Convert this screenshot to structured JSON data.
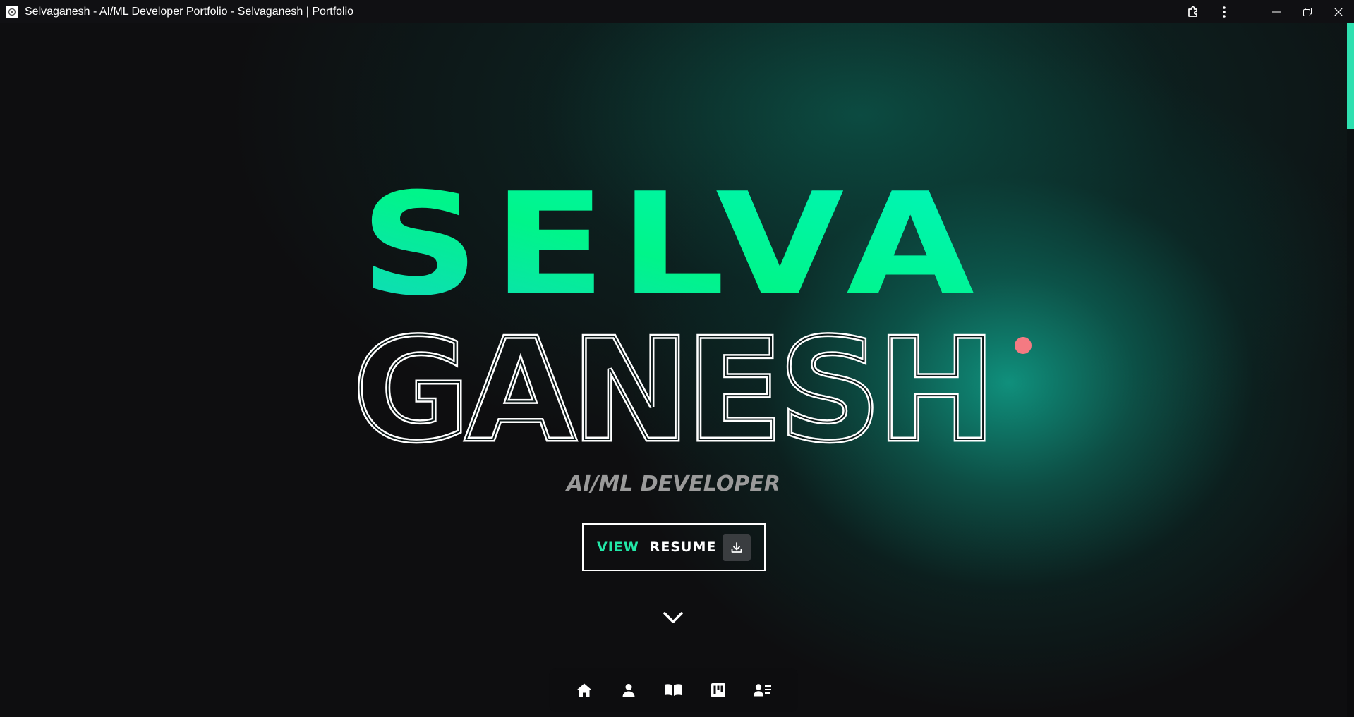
{
  "window": {
    "title": "Selvaganesh - AI/ML Developer Portfolio - Selvaganesh | Portfolio",
    "icons": [
      "extensions-icon",
      "more-vertical-icon",
      "minimize-icon",
      "restore-icon",
      "close-icon"
    ]
  },
  "hero": {
    "title_line1": "SELVA",
    "title_line2": "GANESH",
    "subtitle": "AI/ML DEVELOPER",
    "resume_button": {
      "view_label": "VIEW",
      "resume_label": "RESUME",
      "icon": "download-icon"
    },
    "scroll_hint_icon": "chevron-down-icon"
  },
  "bottom_nav": {
    "items": [
      {
        "name": "home",
        "icon": "home-icon"
      },
      {
        "name": "about",
        "icon": "user-icon"
      },
      {
        "name": "blog",
        "icon": "book-open-icon"
      },
      {
        "name": "projects",
        "icon": "kanban-icon"
      },
      {
        "name": "contact",
        "icon": "contact-card-icon"
      }
    ]
  },
  "colors": {
    "accent_green": "#22e8a8",
    "gradient_start": "#12d6c0",
    "gradient_mid": "#00f58a",
    "gradient_end": "#00f5c0",
    "cursor_dot": "#f47a82",
    "background": "#0e0e10"
  }
}
